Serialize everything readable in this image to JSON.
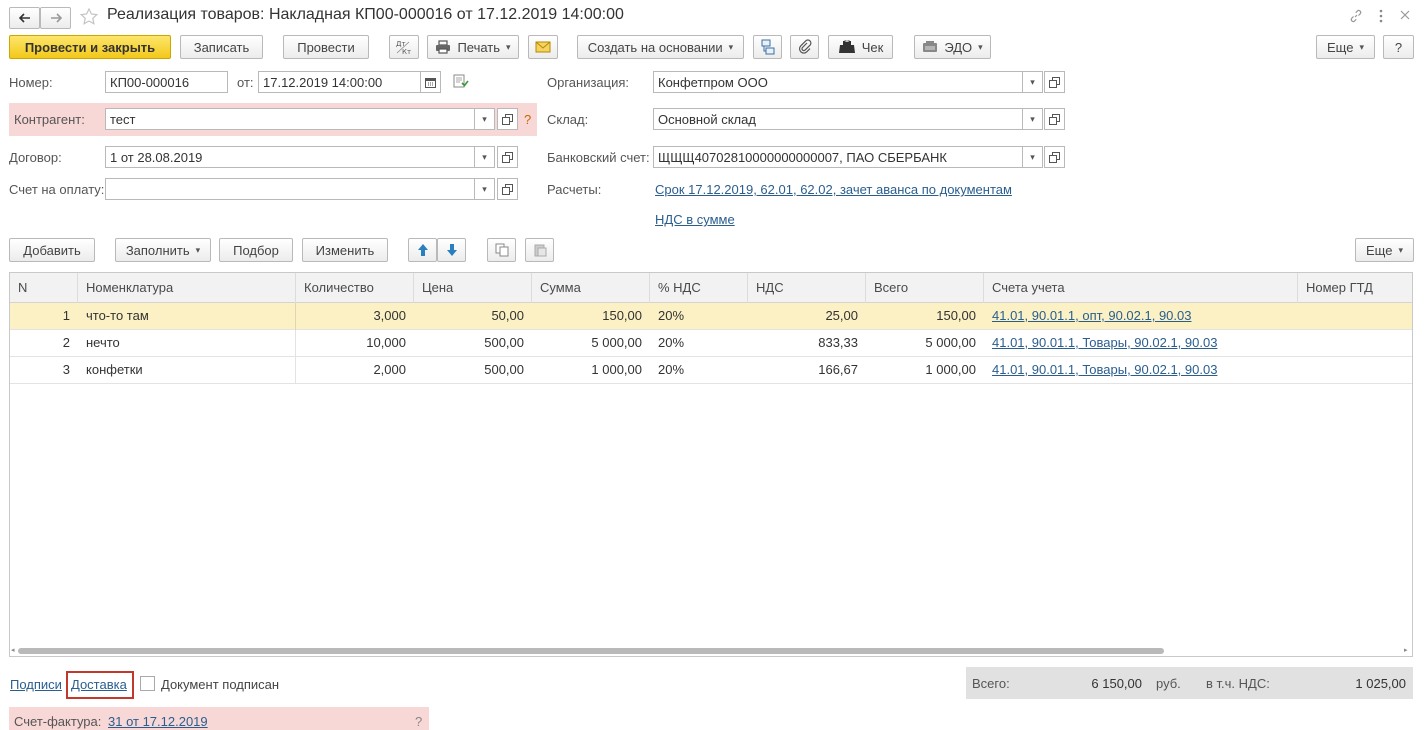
{
  "window": {
    "title": "Реализация товаров: Накладная КП00-000016 от 17.12.2019 14:00:00"
  },
  "toolbar": {
    "post_close": "Провести и закрыть",
    "save": "Записать",
    "post": "Провести",
    "dtkt": "Дт Кт",
    "print": "Печать",
    "create_based": "Создать на основании",
    "check": "Чек",
    "edo": "ЭДО",
    "more": "Еще",
    "help": "?"
  },
  "header": {
    "number_label": "Номер:",
    "number_value": "КП00-000016",
    "date_label": "от:",
    "date_value": "17.12.2019 14:00:00",
    "contractor_label": "Контрагент:",
    "contractor_value": "тест",
    "contract_label": "Договор:",
    "contract_value": "1 от 28.08.2019",
    "invoice_label": "Счет на оплату:",
    "invoice_value": "",
    "org_label": "Организация:",
    "org_value": "Конфетпром ООО",
    "warehouse_label": "Склад:",
    "warehouse_value": "Основной склад",
    "bank_label": "Банковский счет:",
    "bank_value": "ЩЩЩ40702810000000000007, ПАО СБЕРБАНК",
    "settlements_label": "Расчеты:",
    "settlements_link": "Срок 17.12.2019, 62.01, 62.02, зачет аванса по документам",
    "vat_link": "НДС в сумме",
    "question": "?"
  },
  "table_toolbar": {
    "add": "Добавить",
    "fill": "Заполнить",
    "select": "Подбор",
    "change": "Изменить",
    "more": "Еще"
  },
  "table": {
    "columns": [
      "N",
      "Номенклатура",
      "Количество",
      "Цена",
      "Сумма",
      "% НДС",
      "НДС",
      "Всего",
      "Счета учета",
      "Номер ГТД"
    ],
    "rows": [
      {
        "n": "1",
        "name": "что-то там",
        "qty": "3,000",
        "price": "50,00",
        "sum": "150,00",
        "vat_rate": "20%",
        "vat": "25,00",
        "total": "150,00",
        "accounts": "41.01, 90.01.1, опт, 90.02.1, 90.03",
        "gtd": ""
      },
      {
        "n": "2",
        "name": "нечто",
        "qty": "10,000",
        "price": "500,00",
        "sum": "5 000,00",
        "vat_rate": "20%",
        "vat": "833,33",
        "total": "5 000,00",
        "accounts": "41.01, 90.01.1, Товары, 90.02.1, 90.03",
        "gtd": ""
      },
      {
        "n": "3",
        "name": "конфетки",
        "qty": "2,000",
        "price": "500,00",
        "sum": "1 000,00",
        "vat_rate": "20%",
        "vat": "166,67",
        "total": "1 000,00",
        "accounts": "41.01, 90.01.1, Товары, 90.02.1, 90.03",
        "gtd": ""
      }
    ]
  },
  "footer": {
    "signatures_link": "Подписи",
    "delivery_link": "Доставка",
    "signed_label": "Документ подписан",
    "total_label": "Всего:",
    "total_value": "6 150,00",
    "currency": "руб.",
    "vat_label": "в т.ч. НДС:",
    "vat_value": "1 025,00",
    "invoice_label": "Счет-фактура:",
    "invoice_link": "31 от 17.12.2019",
    "question": "?"
  },
  "colors": {
    "accent_yellow": "#f2c81a",
    "link": "#2a5e8f",
    "error_pink": "#f8d7d7",
    "selected_row": "#fbf1c4",
    "highlight_box": "#c0392b"
  }
}
